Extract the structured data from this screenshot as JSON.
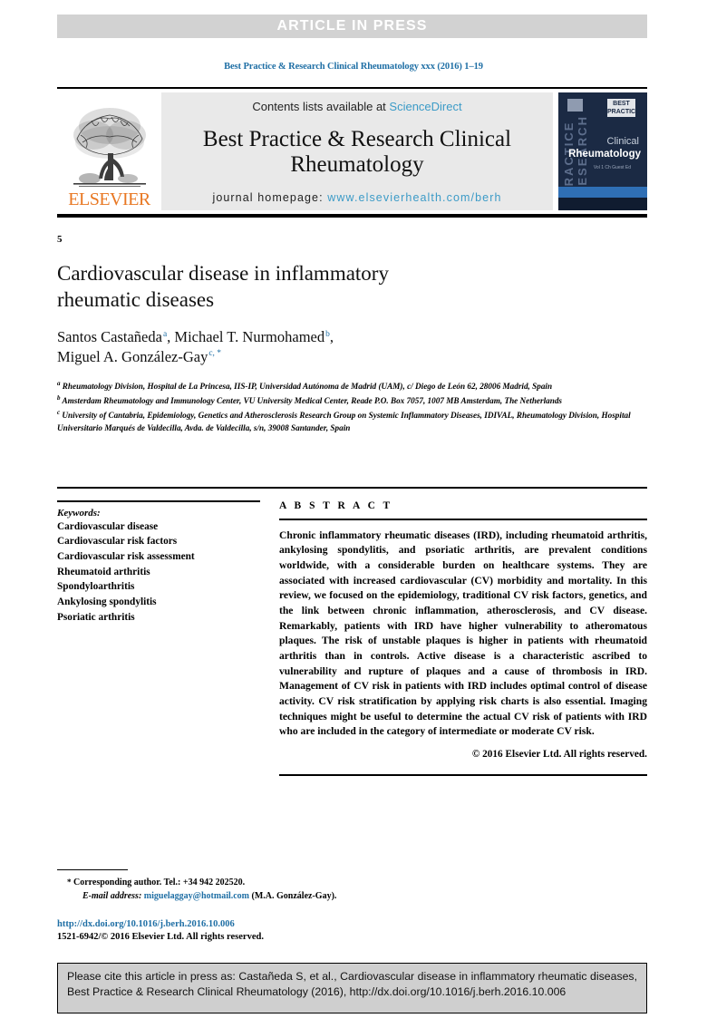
{
  "banner": {
    "label": "ARTICLE IN PRESS"
  },
  "journal_ref": "Best Practice & Research Clinical Rheumatology xxx (2016) 1–19",
  "masthead": {
    "contents_prefix": "Contents lists available at ",
    "contents_link": "ScienceDirect",
    "journal_title_line1": "Best Practice & Research Clinical",
    "journal_title_line2": "Rheumatology",
    "homepage_prefix": "journal homepage: ",
    "homepage_url": "www.elsevierhealth.com/berh",
    "publisher": "ELSEVIER",
    "cover": {
      "vertical_text": "PRACTICE RESEARCH",
      "badge_text": "BEST PRACTICE",
      "line1": "Clinical",
      "line2": "Rheumatology",
      "small_text": "Vol 1 Ch\nGuest Ed"
    }
  },
  "article": {
    "page_number": "5",
    "title_line1": "Cardiovascular disease in inflammatory",
    "title_line2": "rheumatic diseases",
    "authors": [
      {
        "name": "Santos Castañeda",
        "marks": "a",
        "trailing": ","
      },
      {
        "name": "Michael T. Nurmohamed",
        "marks": "b",
        "trailing": ","
      },
      {
        "name": "Miguel A. González-Gay",
        "marks": "c, *",
        "trailing": ""
      }
    ],
    "affiliations": [
      {
        "mark": "a",
        "text": "Rheumatology Division, Hospital de La Princesa, IIS-IP, Universidad Autónoma de Madrid (UAM), c/ Diego de León 62, 28006 Madrid, Spain"
      },
      {
        "mark": "b",
        "text": "Amsterdam Rheumatology and Immunology Center, VU University Medical Center, Reade P.O. Box 7057, 1007 MB Amsterdam, The Netherlands"
      },
      {
        "mark": "c",
        "text": "University of Cantabria, Epidemiology, Genetics and Atherosclerosis Research Group on Systemic Inflammatory Diseases, IDIVAL, Rheumatology Division, Hospital Universitario Marqués de Valdecilla, Avda. de Valdecilla, s/n, 39008 Santander, Spain"
      }
    ]
  },
  "keywords": {
    "heading": "Keywords:",
    "items": [
      "Cardiovascular disease",
      "Cardiovascular risk factors",
      "Cardiovascular risk assessment",
      "Rheumatoid arthritis",
      "Spondyloarthritis",
      "Ankylosing spondylitis",
      "Psoriatic arthritis"
    ]
  },
  "abstract": {
    "heading": "A B S T R A C T",
    "body": "Chronic inflammatory rheumatic diseases (IRD), including rheumatoid arthritis, ankylosing spondylitis, and psoriatic arthritis, are prevalent conditions worldwide, with a considerable burden on healthcare systems. They are associated with increased cardiovascular (CV) morbidity and mortality. In this review, we focused on the epidemiology, traditional CV risk factors, genetics, and the link between chronic inflammation, atherosclerosis, and CV disease. Remarkably, patients with IRD have higher vulnerability to atheromatous plaques. The risk of unstable plaques is higher in patients with rheumatoid arthritis than in controls. Active disease is a characteristic ascribed to vulnerability and rupture of plaques and a cause of thrombosis in IRD. Management of CV risk in patients with IRD includes optimal control of disease activity. CV risk stratification by applying risk charts is also essential. Imaging techniques might be useful to determine the actual CV risk of patients with IRD who are included in the category of intermediate or moderate CV risk.",
    "copyright": "© 2016 Elsevier Ltd. All rights reserved."
  },
  "footnotes": {
    "corresponding": "Corresponding author. Tel.: +34 942 202520.",
    "email_label": "E-mail address:",
    "email": "miguelaggay@hotmail.com",
    "email_owner": "(M.A. González-Gay).",
    "doi": "http://dx.doi.org/10.1016/j.berh.2016.10.006",
    "issn": "1521-6942/© 2016 Elsevier Ltd. All rights reserved."
  },
  "cite_box": {
    "text": "Please cite this article in press as: Castañeda S, et al., Cardiovascular disease in inflammatory rheumatic diseases, Best Practice & Research Clinical Rheumatology (2016), http://dx.doi.org/10.1016/j.berh.2016.10.006"
  },
  "colors": {
    "link": "#3c9bc7",
    "journal_ref": "#1f6fa5",
    "elsevier_orange": "#e87722",
    "banner_bg": "#d2d2d2",
    "masthead_bg": "#e9e9e9",
    "cover_navy": "#1b2a44",
    "cite_box_bg": "#cfcfcf"
  }
}
